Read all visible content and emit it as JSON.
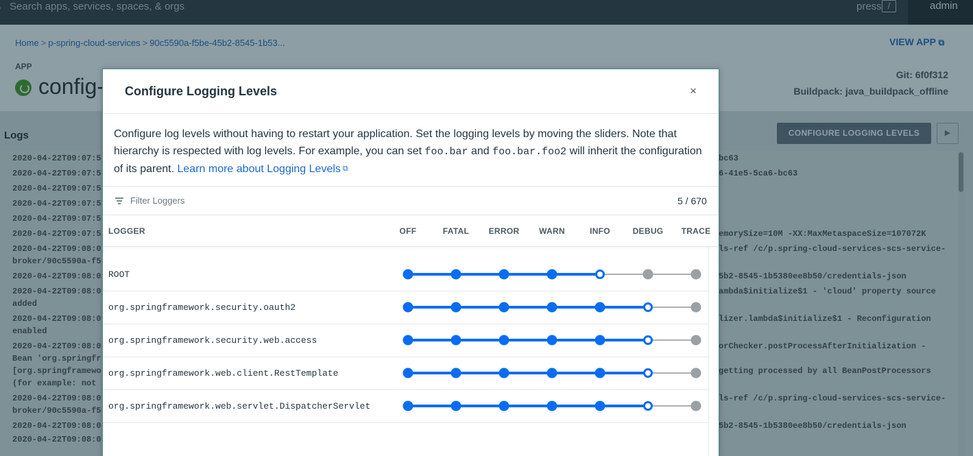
{
  "topbar": {
    "search_placeholder": "Search apps, services, spaces, & orgs",
    "press_label": "press",
    "shortcut_key": "/",
    "user": "admin"
  },
  "breadcrumb": {
    "home": "Home",
    "space": "p-spring-cloud-services",
    "app": "90c5590a-f5be-45b2-8545-1b53..."
  },
  "header": {
    "view_app": "VIEW APP",
    "app_label": "APP",
    "app_name": "config-s",
    "git": "Git: 6f0f312",
    "buildpack": "Buildpack: java_buildpack_offline"
  },
  "logs": {
    "title": "Logs",
    "configure_button": "CONFIGURE LOGGING LEVELS",
    "left_lines": [
      "2020-04-22T09:07:5",
      "2020-04-22T09:07:5",
      "2020-04-22T09:07:5",
      "2020-04-22T09:07:5",
      "2020-04-22T09:07:5",
      "2020-04-22T09:07:5",
      "2020-04-22T09:08:0",
      "broker/90c5590a-f5",
      "2020-04-22T09:08:0",
      "2020-04-22T09:08:0",
      "added",
      "2020-04-22T09:08:0",
      "enabled",
      "2020-04-22T09:08:0",
      "Bean 'org.springfr",
      "[org.springframewo",
      "(for example: not",
      "2020-04-22T09:08:0",
      "broker/90c5590a-f5",
      "2020-04-22T09:08:0",
      "2020-04-22T09:08:0"
    ],
    "right_lines": [
      "bc63",
      "6-41e5-5ca6-bc63",
      "emorySize=10M -XX:MaxMetaspaceSize=107072K",
      "ls-ref /c/p.spring-cloud-services-scs-service-",
      "5b2-8545-1b5380ee8b50/credentials-json",
      "ambda$initialize$1 - 'cloud' property source",
      "lizer.lambda$initialize$1 - Reconfiguration",
      "orChecker.postProcessAfterInitialization -",
      " getting processed by all BeanPostProcessors",
      "ls-ref /c/p.spring-cloud-services-scs-service-",
      "5b2-8545-1b5380ee8b50/credentials-json"
    ]
  },
  "modal": {
    "title": "Configure Logging Levels",
    "close": "×",
    "desc_1": "Configure log levels without having to restart your application. Set the logging levels by moving the sliders. Note that hierarchy is respected with log levels. For example, you can set ",
    "desc_code_1": "foo.bar",
    "desc_2": " and ",
    "desc_code_2": "foo.bar.foo2",
    "desc_3": " will inherit the configuration of its parent. ",
    "learn_more": "Learn more about Logging Levels",
    "filter_placeholder": "Filter Loggers",
    "count": "5 / 670",
    "column_logger": "LOGGER",
    "levels": [
      "OFF",
      "FATAL",
      "ERROR",
      "WARN",
      "INFO",
      "DEBUG",
      "TRACE"
    ],
    "loggers": [
      {
        "name": "ROOT",
        "level": "INFO"
      },
      {
        "name": "org.springframework.security.oauth2",
        "level": "DEBUG"
      },
      {
        "name": "org.springframework.security.web.access",
        "level": "DEBUG"
      },
      {
        "name": "org.springframework.web.client.RestTemplate",
        "level": "DEBUG"
      },
      {
        "name": "org.springframework.web.servlet.DispatcherServlet",
        "level": "DEBUG"
      }
    ]
  },
  "colors": {
    "active": "#0a6df0",
    "inactive": "#9aa0a4",
    "inactive_line": "#8e969b"
  }
}
